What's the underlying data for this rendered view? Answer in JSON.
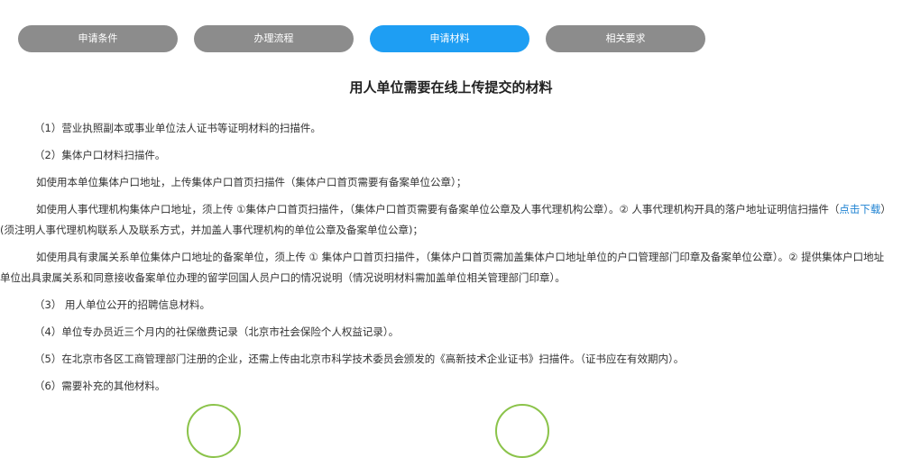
{
  "tabs": [
    {
      "label": "申请条件",
      "active": false
    },
    {
      "label": "办理流程",
      "active": false
    },
    {
      "label": "申请材料",
      "active": true
    },
    {
      "label": "相关要求",
      "active": false
    }
  ],
  "title": "用人单位需要在线上传提交的材料",
  "items": {
    "i1": "（1）营业执照副本或事业单位法人证书等证明材料的扫描件。",
    "i2": "（2）集体户口材料扫描件。",
    "p1": "如使用本单位集体户口地址，上传集体户口首页扫描件（集体户口首页需要有备案单位公章）；",
    "p2a": "如使用人事代理机构集体户口地址，须上传 ①集体户口首页扫描件，（集体户口首页需要有备案单位公章及人事代理机构公章）。② 人事代理机构开具的落户地址证明信扫描件（",
    "p2link": "点击下载",
    "p2b": "）(须注明人事代理机构联系人及联系方式，并加盖人事代理机构的单位公章及备案单位公章)；",
    "p3": "如使用具有隶属关系单位集体户口地址的备案单位，须上传 ① 集体户口首页扫描件，（集体户口首页需加盖集体户口地址单位的户口管理部门印章及备案单位公章）。② 提供集体户口地址单位出具隶属关系和同意接收备案单位办理的留学回国人员户口的情况说明（情况说明材料需加盖单位相关管理部门印章）。",
    "i3": "（3） 用人单位公开的招聘信息材料。",
    "i4": "（4）单位专办员近三个月内的社保缴费记录（北京市社会保险个人权益记录）。",
    "i5": "（5）在北京市各区工商管理部门注册的企业，还需上传由北京市科学技术委员会颁发的《高新技术企业证书》扫描件。（证书应在有效期内）。",
    "i6": "（6）需要补充的其他材料。"
  },
  "colors": {
    "tab_inactive": "#8c8c8c",
    "tab_active": "#1e9ef3",
    "link": "#1e82d2",
    "circle_border": "#8bc34a"
  }
}
